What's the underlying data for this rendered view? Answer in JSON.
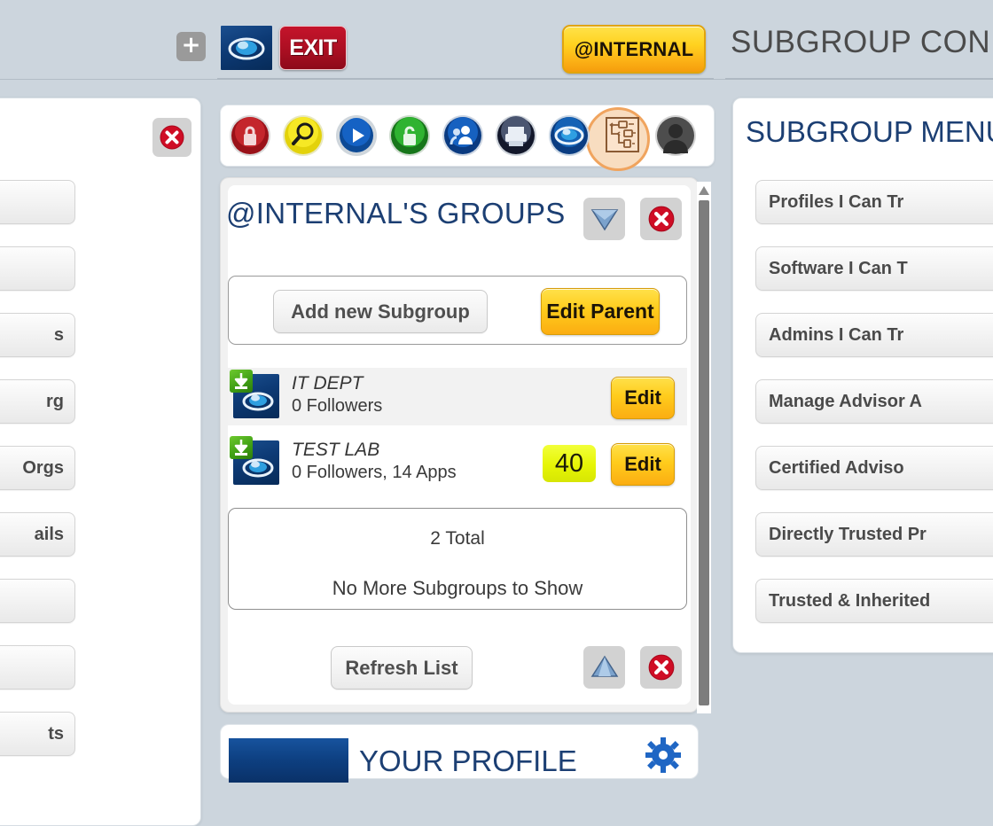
{
  "header": {
    "add_label": "+",
    "exit_label": "EXIT",
    "account_badge": "@INTERNAL",
    "page_title": "SUBGROUP CONFIGU",
    "logo_name": "cloud-logo"
  },
  "icon_bar": {
    "icons": [
      {
        "name": "red-lock-icon",
        "label": "Locked"
      },
      {
        "name": "magnifier-icon",
        "label": "Search"
      },
      {
        "name": "play-icon",
        "label": "Play"
      },
      {
        "name": "green-unlock-icon",
        "label": "Unlocked"
      },
      {
        "name": "users-icon",
        "label": "Users"
      },
      {
        "name": "printer-icon",
        "label": "Print"
      },
      {
        "name": "cloud-icon",
        "label": "Cloud"
      },
      {
        "name": "hierarchy-tree-icon",
        "label": "Subgroups"
      },
      {
        "name": "avatar-icon",
        "label": "Profile"
      }
    ],
    "highlighted_index": 7,
    "highlight_color": "#f6c79a"
  },
  "groups_panel": {
    "title": "@INTERNAL'S GROUPS",
    "collapse_icon": "down-triangle-icon",
    "close_icon": "red-x-icon",
    "add_subgroup_label": "Add new Subgroup",
    "edit_parent_label": "Edit Parent",
    "rows": [
      {
        "name": "IT DEPT",
        "detail": "0 Followers",
        "badge": null,
        "edit_label": "Edit"
      },
      {
        "name": "TEST LAB",
        "detail": "0 Followers, 14 Apps",
        "badge": "40",
        "edit_label": "Edit"
      }
    ],
    "total_label": "2 Total",
    "no_more_label": "No More Subgroups to Show",
    "refresh_label": "Refresh List",
    "scroll_up_icon": "up-triangle-icon",
    "bottom_close_icon": "red-x-icon"
  },
  "profile_panel": {
    "title": "YOUR PROFILE",
    "gear_icon": "gear-icon"
  },
  "subgroup_menu": {
    "title": "SUBGROUP MENU",
    "items": [
      {
        "label": "Profiles I Can Tr"
      },
      {
        "label": "Software I Can T"
      },
      {
        "label": "Admins I Can Tr"
      },
      {
        "label": "Manage Advisor A"
      },
      {
        "label": "Certified Adviso"
      },
      {
        "label": "Directly Trusted Pr"
      },
      {
        "label": "Trusted & Inherited"
      }
    ]
  },
  "left_menu": {
    "close_icon": "red-x-icon",
    "items": [
      {
        "label": ""
      },
      {
        "label": ""
      },
      {
        "label": "s"
      },
      {
        "label": "rg"
      },
      {
        "label": "Orgs"
      },
      {
        "label": "ails"
      },
      {
        "label": ""
      },
      {
        "label": ""
      },
      {
        "label": "ts"
      }
    ]
  },
  "colors": {
    "background": "#ccd5dd",
    "title_blue": "#1c3f73",
    "gold": "#fbad12",
    "red": "#c4142b",
    "badge_yellow": "#e6f505"
  }
}
